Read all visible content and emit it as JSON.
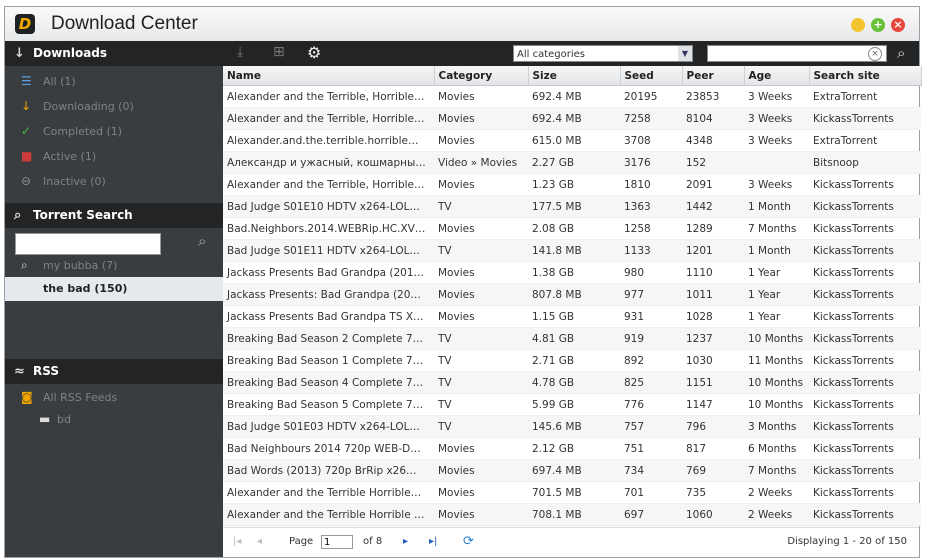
{
  "window": {
    "title": "Download Center"
  },
  "colors": {
    "min": "#f4c430",
    "max": "#6abf3a",
    "close": "#e8473c"
  },
  "sidebar": {
    "downloads_header": "Downloads",
    "items": [
      {
        "label": "All (1)",
        "icon": "list-icon",
        "color": "#5aa0e0",
        "symbol": "☰"
      },
      {
        "label": "Downloading (0)",
        "icon": "download-arrow-icon",
        "color": "#f0a500",
        "symbol": "↓"
      },
      {
        "label": "Completed (1)",
        "icon": "checkmark-icon",
        "color": "#4db848",
        "symbol": "✓"
      },
      {
        "label": "Active (1)",
        "icon": "active-icon",
        "color": "#d23b3b",
        "symbol": "■"
      },
      {
        "label": "Inactive (0)",
        "icon": "inactive-icon",
        "color": "#8a8f93",
        "symbol": "⊖"
      }
    ],
    "torrent_search_header": "Torrent Search",
    "search_placeholder": "",
    "saved_searches": [
      {
        "label": "my bubba (7)"
      }
    ],
    "selected_search": "the bad (150)",
    "rss_header": "RSS",
    "rss_items": [
      {
        "label": "All RSS Feeds"
      },
      {
        "label": "bd"
      }
    ]
  },
  "toolbar": {
    "category": "All categories",
    "search_value": ""
  },
  "table": {
    "columns": [
      "Name",
      "Category",
      "Size",
      "Seed",
      "Peer",
      "Age",
      "Search site"
    ],
    "rows": [
      [
        "Alexander and the Terrible, Horrible…",
        "Movies",
        "692.4 MB",
        "20195",
        "23853",
        "3 Weeks",
        "ExtraTorrent"
      ],
      [
        "Alexander and the Terrible, Horrible…",
        "Movies",
        "692.4 MB",
        "7258",
        "8104",
        "3 Weeks",
        "KickassTorrents"
      ],
      [
        "Alexander.and.the.terrible.horrible…",
        "Movies",
        "615.0 MB",
        "3708",
        "4348",
        "3 Weeks",
        "ExtraTorrent"
      ],
      [
        "Александр и ужасный, кошмарны…",
        "Video » Movies",
        "2.27 GB",
        "3176",
        "152",
        "",
        "Bitsnoop"
      ],
      [
        "Alexander and the Terrible, Horrible…",
        "Movies",
        "1.23 GB",
        "1810",
        "2091",
        "3 Weeks",
        "KickassTorrents"
      ],
      [
        "Bad Judge S01E10 HDTV x264-LOL…",
        "TV",
        "177.5 MB",
        "1363",
        "1442",
        "1 Month",
        "KickassTorrents"
      ],
      [
        "Bad.Neighbors.2014.WEBRip.HC.XV…",
        "Movies",
        "2.08 GB",
        "1258",
        "1289",
        "7 Months",
        "KickassTorrents"
      ],
      [
        "Bad Judge S01E11 HDTV x264-LOL…",
        "TV",
        "141.8 MB",
        "1133",
        "1201",
        "1 Month",
        "KickassTorrents"
      ],
      [
        "Jackass Presents Bad Grandpa (201…",
        "Movies",
        "1.38 GB",
        "980",
        "1110",
        "1 Year",
        "KickassTorrents"
      ],
      [
        "Jackass Presents: Bad Grandpa (20…",
        "Movies",
        "807.8 MB",
        "977",
        "1011",
        "1 Year",
        "KickassTorrents"
      ],
      [
        "Jackass Presents Bad Grandpa TS X…",
        "Movies",
        "1.15 GB",
        "931",
        "1028",
        "1 Year",
        "KickassTorrents"
      ],
      [
        "Breaking Bad Season 2 Complete 7…",
        "TV",
        "4.81 GB",
        "919",
        "1237",
        "10 Months",
        "KickassTorrents"
      ],
      [
        "Breaking Bad Season 1 Complete 7…",
        "TV",
        "2.71 GB",
        "892",
        "1030",
        "11 Months",
        "KickassTorrents"
      ],
      [
        "Breaking Bad Season 4 Complete 7…",
        "TV",
        "4.78 GB",
        "825",
        "1151",
        "10 Months",
        "KickassTorrents"
      ],
      [
        "Breaking Bad Season 5 Complete 7…",
        "TV",
        "5.99 GB",
        "776",
        "1147",
        "10 Months",
        "KickassTorrents"
      ],
      [
        "Bad Judge S01E03 HDTV x264-LOL…",
        "TV",
        "145.6 MB",
        "757",
        "796",
        "3 Months",
        "KickassTorrents"
      ],
      [
        "Bad Neighbours 2014 720p WEB-D…",
        "Movies",
        "2.12 GB",
        "751",
        "817",
        "6 Months",
        "KickassTorrents"
      ],
      [
        "Bad Words (2013) 720p BrRip x26…",
        "Movies",
        "697.4 MB",
        "734",
        "769",
        "7 Months",
        "KickassTorrents"
      ],
      [
        "Alexander and the Terrible Horrible…",
        "Movies",
        "701.5 MB",
        "701",
        "735",
        "2 Weeks",
        "KickassTorrents"
      ],
      [
        "Alexander and the Terrible Horrible …",
        "Movies",
        "708.1 MB",
        "697",
        "1060",
        "2 Weeks",
        "KickassTorrents"
      ]
    ]
  },
  "pager": {
    "page_label": "Page",
    "page_value": "1",
    "of_label": "of 8",
    "display": "Displaying 1 - 20 of 150"
  }
}
